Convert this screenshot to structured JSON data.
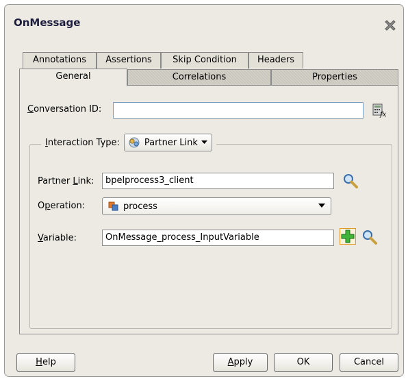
{
  "dialog": {
    "title": "OnMessage"
  },
  "tabs": {
    "back": [
      "Annotations",
      "Assertions",
      "Skip Condition",
      "Headers"
    ],
    "front": [
      "General",
      "Correlations",
      "Properties"
    ],
    "active": "General"
  },
  "general": {
    "conversation_id": {
      "label_u": "C",
      "label_rest": "onversation ID:",
      "value": ""
    },
    "interaction_type": {
      "label_u": "I",
      "label_rest": "nteraction Type:",
      "value": "Partner Link"
    },
    "partner_link": {
      "label_pre": "Partner ",
      "label_u": "L",
      "label_rest": "ink:",
      "value": "bpelprocess3_client"
    },
    "operation": {
      "label_pre": "O",
      "label_u": "p",
      "label_rest": "eration:",
      "value": "process"
    },
    "variable": {
      "label_u": "V",
      "label_rest": "ariable:",
      "value": "OnMessage_process_InputVariable"
    }
  },
  "buttons": {
    "help_u": "H",
    "help_rest": "elp",
    "apply_u": "A",
    "apply_rest": "pply",
    "ok": "OK",
    "cancel": "Cancel"
  }
}
